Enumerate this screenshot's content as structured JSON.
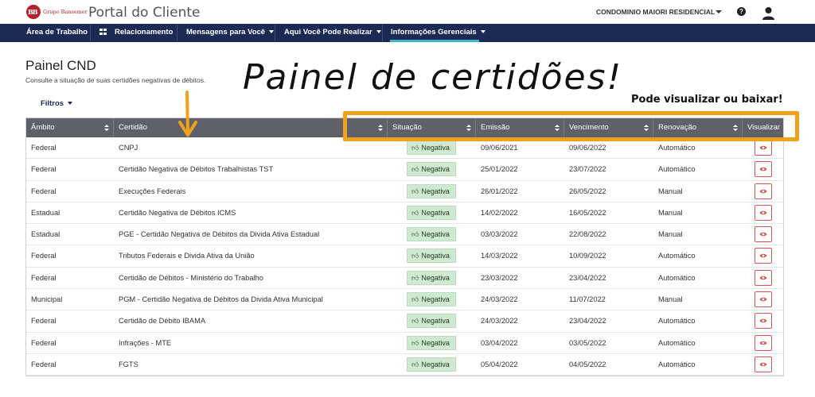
{
  "header": {
    "brand_text": "Grupo Bansemer",
    "portal_title": "Portal do Cliente",
    "account_name": "CONDOMINIO MAIORI RESIDENCIAL",
    "help_label": "?"
  },
  "nav": {
    "items": [
      {
        "label": "Área de Trabalho"
      },
      {
        "label": "Relacionamento"
      },
      {
        "label": "Mensagens para Você"
      },
      {
        "label": "Aqui Você Pode Realizar"
      },
      {
        "label": "Informações Gerenciais"
      }
    ],
    "active_color": "#3fb6c9",
    "bar_color": "#1b2a55"
  },
  "page": {
    "title": "Painel CND",
    "subtitle": "Consulte a situação de suas certidões negativas de débitos.",
    "filters_label": "Filtros"
  },
  "annotations": {
    "big": "Painel de certidões!",
    "small": "Pode visualizar ou baixar!",
    "highlight_color": "#f0a31a"
  },
  "table": {
    "headers": {
      "ambito": "Âmbito",
      "certidao": "Certidão",
      "situacao": "Situação",
      "emissao": "Emissão",
      "vencimento": "Vencimento",
      "renovacao": "Renovação",
      "visualizar": "Visualizar"
    },
    "status_icon": "thumbs-up-icon",
    "action_icon": "eye-icon",
    "rows": [
      {
        "ambito": "Federal",
        "certidao": "CNPJ",
        "situacao": "Negativa",
        "emissao": "09/06/2021",
        "vencimento": "09/06/2022",
        "renovacao": "Automático"
      },
      {
        "ambito": "Federal",
        "certidao": "Certidão Negativa de Débitos Trabalhistas TST",
        "situacao": "Negativa",
        "emissao": "25/01/2022",
        "vencimento": "23/07/2022",
        "renovacao": "Automático"
      },
      {
        "ambito": "Federal",
        "certidao": "Execuções Federais",
        "situacao": "Negativa",
        "emissao": "26/01/2022",
        "vencimento": "26/05/2022",
        "renovacao": "Manual"
      },
      {
        "ambito": "Estadual",
        "certidao": "Certidão Negativa de Débitos ICMS",
        "situacao": "Negativa",
        "emissao": "14/02/2022",
        "vencimento": "16/05/2022",
        "renovacao": "Manual"
      },
      {
        "ambito": "Estadual",
        "certidao": "PGE - Certidão Negativa de Débitos da Divida Ativa Estadual",
        "situacao": "Negativa",
        "emissao": "03/03/2022",
        "vencimento": "22/08/2022",
        "renovacao": "Manual"
      },
      {
        "ambito": "Federal",
        "certidao": "Tributos Federais e Divida Ativa da União",
        "situacao": "Negativa",
        "emissao": "14/03/2022",
        "vencimento": "10/09/2022",
        "renovacao": "Automático"
      },
      {
        "ambito": "Federal",
        "certidao": "Certidão de Débitos - Ministério do Trabalho",
        "situacao": "Negativa",
        "emissao": "23/03/2022",
        "vencimento": "23/04/2022",
        "renovacao": "Automático"
      },
      {
        "ambito": "Municipal",
        "certidao": "PGM - Certidão Negativa de Débitos da Divida Ativa Municipal",
        "situacao": "Negativa",
        "emissao": "24/03/2022",
        "vencimento": "11/07/2022",
        "renovacao": "Manual"
      },
      {
        "ambito": "Federal",
        "certidao": "Certidão de Débito IBAMA",
        "situacao": "Negativa",
        "emissao": "24/03/2022",
        "vencimento": "23/04/2022",
        "renovacao": "Automático"
      },
      {
        "ambito": "Federal",
        "certidao": "Infrações - MTE",
        "situacao": "Negativa",
        "emissao": "03/04/2022",
        "vencimento": "03/05/2022",
        "renovacao": "Automático"
      },
      {
        "ambito": "Federal",
        "certidao": "FGTS",
        "situacao": "Negativa",
        "emissao": "05/04/2022",
        "vencimento": "04/05/2022",
        "renovacao": "Automático"
      }
    ]
  }
}
